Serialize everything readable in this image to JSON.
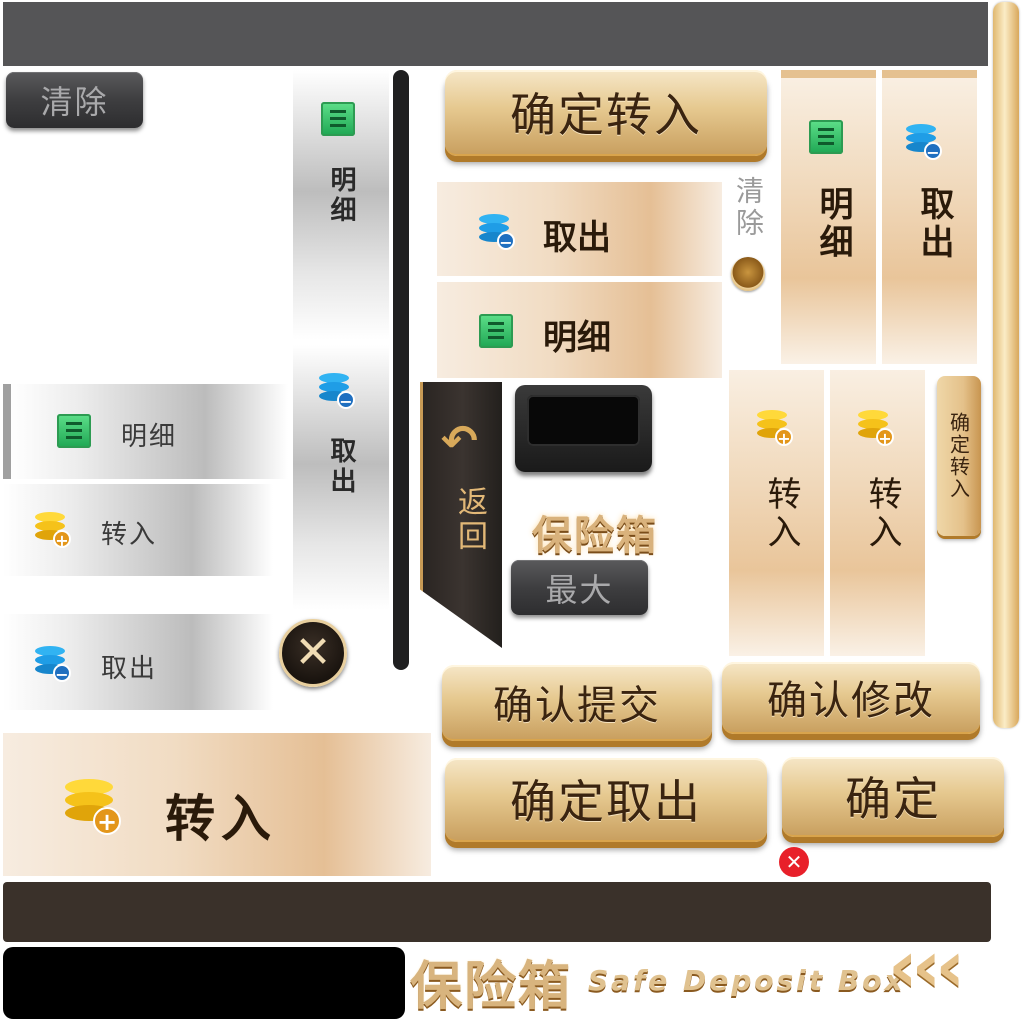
{
  "buttons": {
    "clear_top_left": "清除",
    "confirm_deposit_top": "确定转入",
    "clear_vertical": "清除",
    "back": "返回",
    "max": "最大",
    "confirm_submit": "确认提交",
    "confirm_modify": "确认修改",
    "confirm_withdraw": "确定取出",
    "confirm": "确定",
    "confirm_deposit_small": "确定转入"
  },
  "left_tabs": [
    {
      "label": "明细",
      "icon": "detail-icon"
    },
    {
      "label": "转入",
      "icon": "deposit-coins-icon"
    },
    {
      "label": "取出",
      "icon": "withdraw-coins-icon"
    }
  ],
  "vertical_grey_tabs": [
    {
      "label": "明细",
      "icon": "detail-icon"
    },
    {
      "label": "取出",
      "icon": "withdraw-coins-icon"
    }
  ],
  "beige_tabs": [
    {
      "label": "取出",
      "icon": "withdraw-coins-icon"
    },
    {
      "label": "明细",
      "icon": "detail-icon"
    }
  ],
  "beige_vertical_tabs": [
    {
      "label": "明细",
      "icon": "detail-icon"
    },
    {
      "label": "取出",
      "icon": "withdraw-coins-icon"
    },
    {
      "label": "转入",
      "icon": "deposit-coins-icon"
    },
    {
      "label": "转入",
      "icon": "deposit-coins-icon"
    }
  ],
  "big_tab": {
    "label": "转入",
    "icon": "deposit-coins-icon"
  },
  "title": {
    "chinese": "保险箱",
    "english": "Safe Deposit Box",
    "chinese_small": "保险箱",
    "arrows": "‹‹‹"
  },
  "colors": {
    "gold": "#e6c990",
    "gold_dark": "#b07a2a",
    "bar_dark": "#3a312a",
    "bar_grey": "#555557",
    "coin_gold": "#f5c21a",
    "coin_blue": "#1f9de6",
    "doc_green": "#2fbf63",
    "close_red": "#e8202a"
  }
}
